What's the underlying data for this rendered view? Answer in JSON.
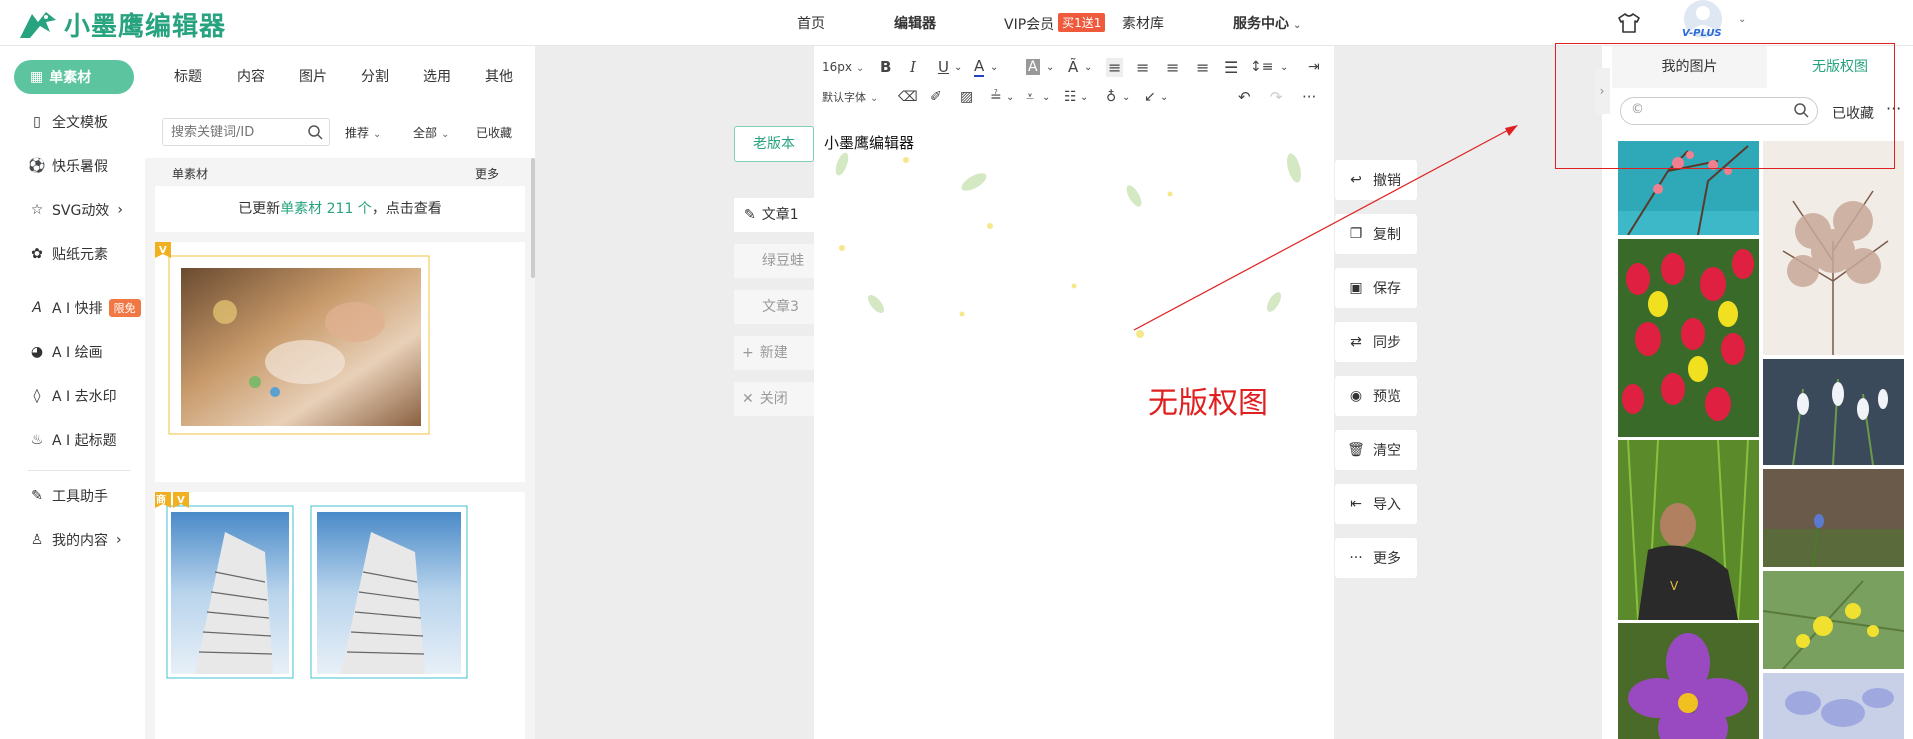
{
  "header": {
    "logo_text": "小墨鹰编辑器",
    "nav": [
      {
        "label": "首页",
        "bold": false
      },
      {
        "label": "编辑器",
        "bold": true
      },
      {
        "label": "VIP会员",
        "bold": false
      },
      {
        "label": "素材库",
        "bold": false
      },
      {
        "label": "服务中心",
        "bold": true
      }
    ],
    "vip_badge": "买1送1",
    "vplus": "V-PLUS"
  },
  "sidebar": {
    "items": [
      {
        "label": "单素材",
        "icon": "grid-icon"
      },
      {
        "label": "全文模板",
        "icon": "template-icon"
      },
      {
        "label": "快乐暑假",
        "icon": "soccer-icon"
      },
      {
        "label": "SVG动效",
        "icon": "star-icon"
      },
      {
        "label": "贴纸元素",
        "icon": "sticker-icon"
      },
      {
        "label": "A I 快排",
        "icon": "ai-icon"
      },
      {
        "label": "A I 绘画",
        "icon": "palette-icon"
      },
      {
        "label": "A I 去水印",
        "icon": "drop-icon"
      },
      {
        "label": "A I 起标题",
        "icon": "flame-icon"
      },
      {
        "label": "工具助手",
        "icon": "tool-icon"
      },
      {
        "label": "我的内容",
        "icon": "user-icon"
      }
    ],
    "free_badge": "限免"
  },
  "material": {
    "tabs": [
      "标题",
      "内容",
      "图片",
      "分割",
      "选用",
      "其他"
    ],
    "search_placeholder": "搜索关键词/ID",
    "sort": "推荐",
    "scope": "全部",
    "favorites": "已收藏",
    "section_title": "单素材",
    "section_more": "更多",
    "notice_prefix": "已更新",
    "notice_highlight": "单素材 211 个",
    "notice_suffix": "，点击查看",
    "badge_v": "V",
    "badge_shang": "商"
  },
  "docs": {
    "old_version": "老版本",
    "tabs": [
      "文章1",
      "绿豆蛙",
      "文章3"
    ],
    "new": "新建",
    "close": "关闭"
  },
  "editor": {
    "font_size": "16px",
    "font_family": "默认字体",
    "content_title": "小墨鹰编辑器"
  },
  "actions": [
    {
      "label": "撤销",
      "icon": "undo-icon"
    },
    {
      "label": "复制",
      "icon": "copy-icon"
    },
    {
      "label": "保存",
      "icon": "save-icon"
    },
    {
      "label": "同步",
      "icon": "sync-icon"
    },
    {
      "label": "预览",
      "icon": "eye-icon"
    },
    {
      "label": "清空",
      "icon": "trash-icon"
    },
    {
      "label": "导入",
      "icon": "import-icon"
    },
    {
      "label": "更多",
      "icon": "more-icon"
    }
  ],
  "annotation": "无版权图",
  "right_panel": {
    "tab_mine": "我的图片",
    "tab_free": "无版权图",
    "search_value": "",
    "favorites": "已收藏",
    "more": "···"
  },
  "colors": {
    "brand": "#27a37f",
    "sidebar_active": "#5cc49e",
    "annotation": "#e02020"
  }
}
